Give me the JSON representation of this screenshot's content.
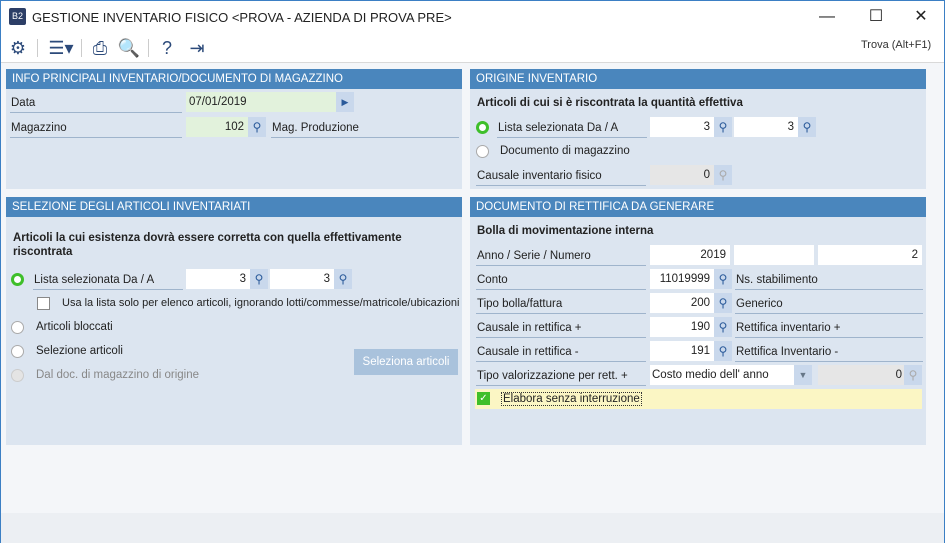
{
  "window": {
    "title": "GESTIONE INVENTARIO FISICO <PROVA - AZIENDA DI PROVA PRE>",
    "logo": "B2",
    "minimize": "—",
    "maximize": "☐",
    "close": "✕"
  },
  "toolbar": {
    "icons": [
      "gears-icon",
      "menu-icon",
      "print-icon",
      "preview-icon",
      "help-icon",
      "exit-icon"
    ],
    "search_label": "Trova (Alt+F1)"
  },
  "info": {
    "header": "INFO PRINCIPALI INVENTARIO/DOCUMENTO DI MAGAZZINO",
    "data_label": "Data",
    "data_value": "07/01/2019",
    "magazzino_label": "Magazzino",
    "magazzino_value": "102",
    "magazzino_desc": "Mag. Produzione"
  },
  "origine": {
    "header": "ORIGINE INVENTARIO",
    "subtitle": "Articoli di cui si è riscontrata la quantità effettiva",
    "lista_label": "Lista selezionata Da / A",
    "lista_da": "3",
    "lista_a": "3",
    "documento_label": "Documento di magazzino",
    "causale_label": "Causale inventario fisico",
    "causale_value": "0"
  },
  "selezione": {
    "header": "SELEZIONE DEGLI ARTICOLI INVENTARIATI",
    "subtitle": "Articoli la cui esistenza dovrà essere corretta con quella effettivamente riscontrata",
    "lista_label": "Lista selezionata Da / A",
    "lista_da": "3",
    "lista_a": "3",
    "usa_lista_label": "Usa la lista solo per elenco articoli, ignorando lotti/commesse/matricole/ubicazioni",
    "bloccati_label": "Articoli bloccati",
    "selezione_label": "Selezione articoli",
    "dal_doc_label": "Dal doc. di magazzino di origine",
    "seleziona_button": "Seleziona articoli"
  },
  "rettifica": {
    "header": "DOCUMENTO DI RETTIFICA DA GENERARE",
    "subtitle": "Bolla di movimentazione interna",
    "anno_label": "Anno / Serie / Numero",
    "anno": "2019",
    "serie": "",
    "numero": "2",
    "conto_label": "Conto",
    "conto": "11019999",
    "conto_desc": "Ns. stabilimento",
    "tipo_label": "Tipo bolla/fattura",
    "tipo": "200",
    "tipo_desc": "Generico",
    "causale_piu_label": "Causale in rettifica +",
    "causale_piu": "190",
    "causale_piu_desc": "Rettifica inventario +",
    "causale_meno_label": "Causale in rettifica -",
    "causale_meno": "191",
    "causale_meno_desc": "Rettifica Inventario -",
    "valorizzazione_label": "Tipo valorizzazione  per rett. +",
    "valorizzazione": "Costo medio dell' anno",
    "valorizzazione_num": "0",
    "elabora_label": "Elabora senza interruzione"
  }
}
